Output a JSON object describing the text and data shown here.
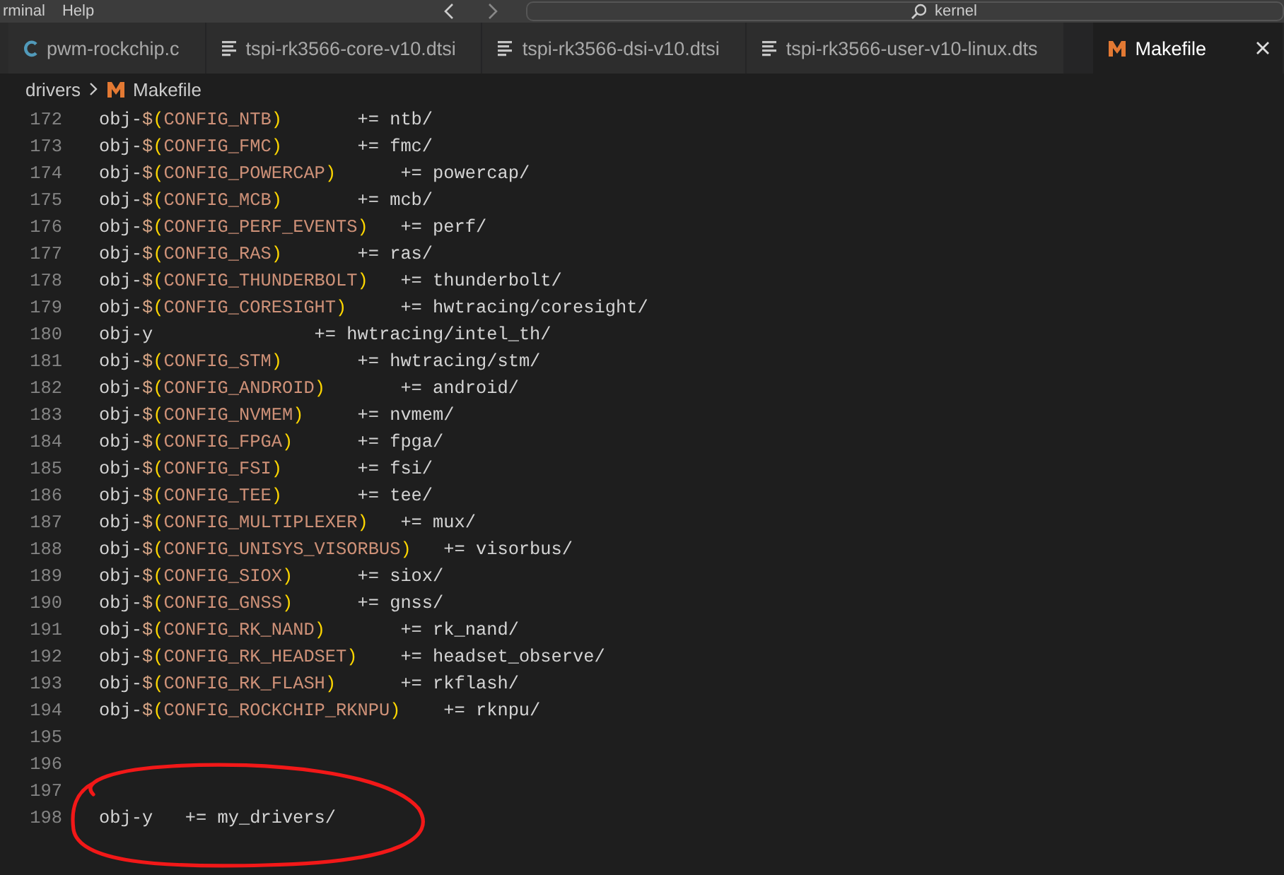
{
  "title_bar": {
    "menu": [
      {
        "label": "rminal"
      },
      {
        "label": "Help"
      }
    ],
    "search": {
      "value": "kernel"
    }
  },
  "tabs": [
    {
      "label": "pwm-rockchip.c",
      "kind": "c",
      "selected": false
    },
    {
      "label": "tspi-rk3566-core-v10.dtsi",
      "kind": "text",
      "selected": false
    },
    {
      "label": "tspi-rk3566-dsi-v10.dtsi",
      "kind": "text",
      "selected": false
    },
    {
      "label": "tspi-rk3566-user-v10-linux.dts",
      "kind": "text",
      "selected": false
    },
    {
      "label": "Makefile",
      "kind": "makefile",
      "selected": true
    }
  ],
  "breadcrumb": [
    {
      "label": "drivers",
      "kind": "folder"
    },
    {
      "label": "Makefile",
      "kind": "makefile"
    }
  ],
  "editor": {
    "lines": [
      {
        "number": "172",
        "text": "obj-$(CONFIG_NTB)\t\t+= ntb/"
      },
      {
        "number": "173",
        "text": "obj-$(CONFIG_FMC)\t\t+= fmc/"
      },
      {
        "number": "174",
        "text": "obj-$(CONFIG_POWERCAP)\t\t+= powercap/"
      },
      {
        "number": "175",
        "text": "obj-$(CONFIG_MCB)\t\t+= mcb/"
      },
      {
        "number": "176",
        "text": "obj-$(CONFIG_PERF_EVENTS)\t+= perf/"
      },
      {
        "number": "177",
        "text": "obj-$(CONFIG_RAS)\t\t+= ras/"
      },
      {
        "number": "178",
        "text": "obj-$(CONFIG_THUNDERBOLT)\t+= thunderbolt/"
      },
      {
        "number": "179",
        "text": "obj-$(CONFIG_CORESIGHT)\t\t+= hwtracing/coresight/"
      },
      {
        "number": "180",
        "text": "obj-y\t\t\t\t+= hwtracing/intel_th/"
      },
      {
        "number": "181",
        "text": "obj-$(CONFIG_STM)\t\t+= hwtracing/stm/"
      },
      {
        "number": "182",
        "text": "obj-$(CONFIG_ANDROID)\t\t+= android/"
      },
      {
        "number": "183",
        "text": "obj-$(CONFIG_NVMEM)\t\t+= nvmem/"
      },
      {
        "number": "184",
        "text": "obj-$(CONFIG_FPGA)\t\t+= fpga/"
      },
      {
        "number": "185",
        "text": "obj-$(CONFIG_FSI)\t\t+= fsi/"
      },
      {
        "number": "186",
        "text": "obj-$(CONFIG_TEE)\t\t+= tee/"
      },
      {
        "number": "187",
        "text": "obj-$(CONFIG_MULTIPLEXER)\t+= mux/"
      },
      {
        "number": "188",
        "text": "obj-$(CONFIG_UNISYS_VISORBUS)\t+= visorbus/"
      },
      {
        "number": "189",
        "text": "obj-$(CONFIG_SIOX)\t\t+= siox/"
      },
      {
        "number": "190",
        "text": "obj-$(CONFIG_GNSS)\t\t+= gnss/"
      },
      {
        "number": "191",
        "text": "obj-$(CONFIG_RK_NAND)\t\t+= rk_nand/"
      },
      {
        "number": "192",
        "text": "obj-$(CONFIG_RK_HEADSET)\t+= headset_observe/"
      },
      {
        "number": "193",
        "text": "obj-$(CONFIG_RK_FLASH)\t\t+= rkflash/"
      },
      {
        "number": "194",
        "text": "obj-$(CONFIG_ROCKCHIP_RKNPU)\t+= rknpu/"
      },
      {
        "number": "195"
      },
      {
        "number": "196"
      },
      {
        "number": "197"
      },
      {
        "number": "198",
        "text": "obj-y\t+= my_drivers/"
      }
    ]
  },
  "annotation": {
    "kind": "freehand-circle"
  }
}
